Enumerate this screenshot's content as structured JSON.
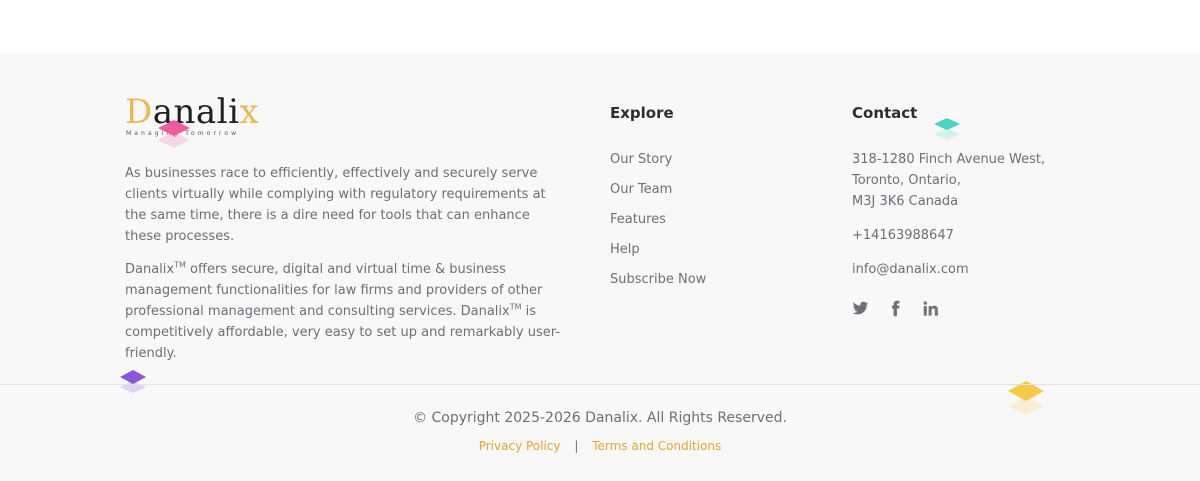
{
  "logo": {
    "wordmark": "Danalix",
    "tagline": "Managing Tomorrow"
  },
  "about": {
    "paragraph1": "As businesses race to efficiently, effectively and securely serve clients virtually while complying with regulatory requirements at the same time, there is a dire need for tools that can enhance these processes.",
    "p2_brand": "Danalix",
    "tm": "TM",
    "p2_text1": " offers secure, digital and virtual time & business management functionalities for law firms and providers of other professional management and consulting services. ",
    "p2_brand2": "Danalix",
    "p2_text2": " is competitively affordable, very easy to set up and remarkably user-friendly."
  },
  "explore": {
    "title": "Explore",
    "items": [
      "Our Story",
      "Our Team",
      "Features",
      "Help",
      "Subscribe Now"
    ]
  },
  "contact": {
    "title": "Contact",
    "address_line1": "318-1280 Finch Avenue West,",
    "address_line2": "Toronto, Ontario,",
    "address_line3": "M3J 3K6 Canada",
    "phone": "+14163988647",
    "email": "info@danalix.com",
    "social_icons": [
      "twitter-icon",
      "facebook-icon",
      "linkedin-icon"
    ]
  },
  "bottom": {
    "copyright": "© Copyright 2025-2026 Danalix. All Rights Reserved.",
    "privacy": "Privacy Policy",
    "separator": "|",
    "terms": "Terms and Conditions"
  },
  "colors": {
    "accent": "#e0a52f",
    "pink": "#f05aa0",
    "teal": "#4fd1c5",
    "purple": "#8a55d6",
    "yellow": "#f7c948"
  }
}
